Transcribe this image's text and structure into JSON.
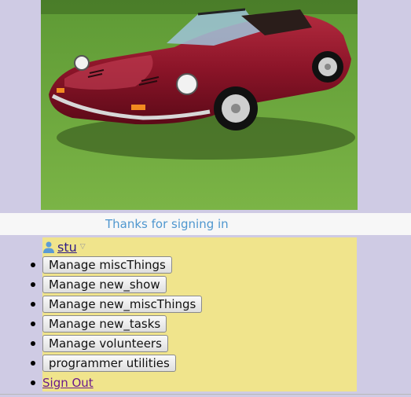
{
  "hero": {
    "image_icon": "red-convertible-sports-car-photo"
  },
  "notice": {
    "text": "Thanks for signing in"
  },
  "user": {
    "icon": "user-icon",
    "name": "stu",
    "dropdown_icon": "caret-down-icon"
  },
  "menu": {
    "items": [
      {
        "label": "Manage miscThings"
      },
      {
        "label": "Manage new_show"
      },
      {
        "label": "Manage new_miscThings"
      },
      {
        "label": "Manage new_tasks"
      },
      {
        "label": "Manage volunteers"
      },
      {
        "label": "programmer utilities"
      }
    ],
    "sign_out": "Sign Out"
  },
  "colors": {
    "page_bg": "#cfcbe4",
    "menu_bg": "#f0e48c",
    "notice_text": "#4f97cf",
    "link": "#6b1a8c",
    "car_body": "#8b1428",
    "grass": "#6aa63a"
  }
}
